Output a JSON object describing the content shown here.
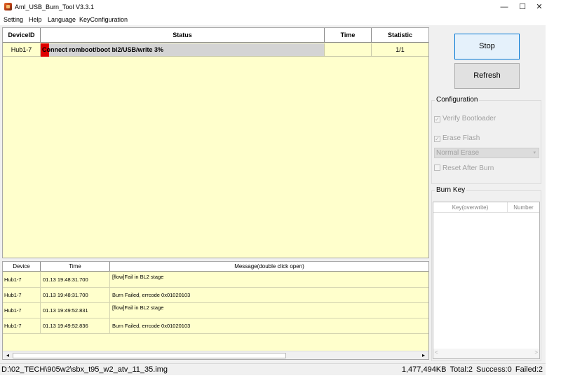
{
  "window": {
    "title": "Aml_USB_Burn_Tool V3.3.1",
    "minimize_glyph": "—",
    "maximize_glyph": "☐",
    "close_glyph": "✕"
  },
  "menu": [
    "Setting",
    "Help",
    "Language",
    "KeyConfiguration"
  ],
  "device_table": {
    "headers": [
      "DeviceID",
      "Status",
      "Time",
      "Statistic"
    ],
    "rows": [
      {
        "device_id": "Hub1-7",
        "status": "Connect romboot/boot bl2/USB/write 3%",
        "time": "",
        "statistic": "1/1"
      }
    ]
  },
  "log_table": {
    "headers": [
      "Device",
      "Time",
      "Message(double click open)"
    ],
    "rows": [
      {
        "device": "Hub1-7",
        "time": "01.13 19:48:31.700",
        "message": "[flow]Fail in BL2 stage"
      },
      {
        "device": "Hub1-7",
        "time": "01.13 19:48:31.700",
        "message": "Burn Failed, errcode 0x01020103"
      },
      {
        "device": "Hub1-7",
        "time": "01.13 19:49:52.831",
        "message": "[flow]Fail in BL2 stage"
      },
      {
        "device": "Hub1-7",
        "time": "01.13 19:49:52.836",
        "message": "Burn Failed, errcode 0x01020103"
      }
    ],
    "scroll_left": "◂",
    "scroll_right": "▸"
  },
  "buttons": {
    "stop": "Stop",
    "refresh": "Refresh"
  },
  "configuration": {
    "label": "Configuration",
    "verify_bootloader": "Verify Bootloader",
    "verify_bootloader_checked": true,
    "erase_flash": "Erase Flash",
    "erase_flash_checked": true,
    "erase_mode": "Normal Erase",
    "reset_after_burn": "Reset After Burn",
    "reset_after_burn_checked": false
  },
  "burn_key": {
    "label": "Burn Key",
    "headers": [
      "Key(overwrite)",
      "Number"
    ],
    "scroll_left": "<",
    "scroll_right": ">"
  },
  "status_bar": {
    "path": "D:\\02_TECH\\905w2\\sbx_t95_w2_atv_11_35.img",
    "size": "1,477,494KB",
    "total": "Total:2",
    "success": "Success:0",
    "failed": "Failed:2"
  },
  "colors": {
    "table_bg": "#ffffcc",
    "progress_red": "#e00000",
    "stop_button_border": "#0078d7"
  },
  "icons": {
    "app": "aml-burn-tool-icon",
    "dropdown": "chevron-down-icon",
    "checkmark": "check-icon"
  }
}
